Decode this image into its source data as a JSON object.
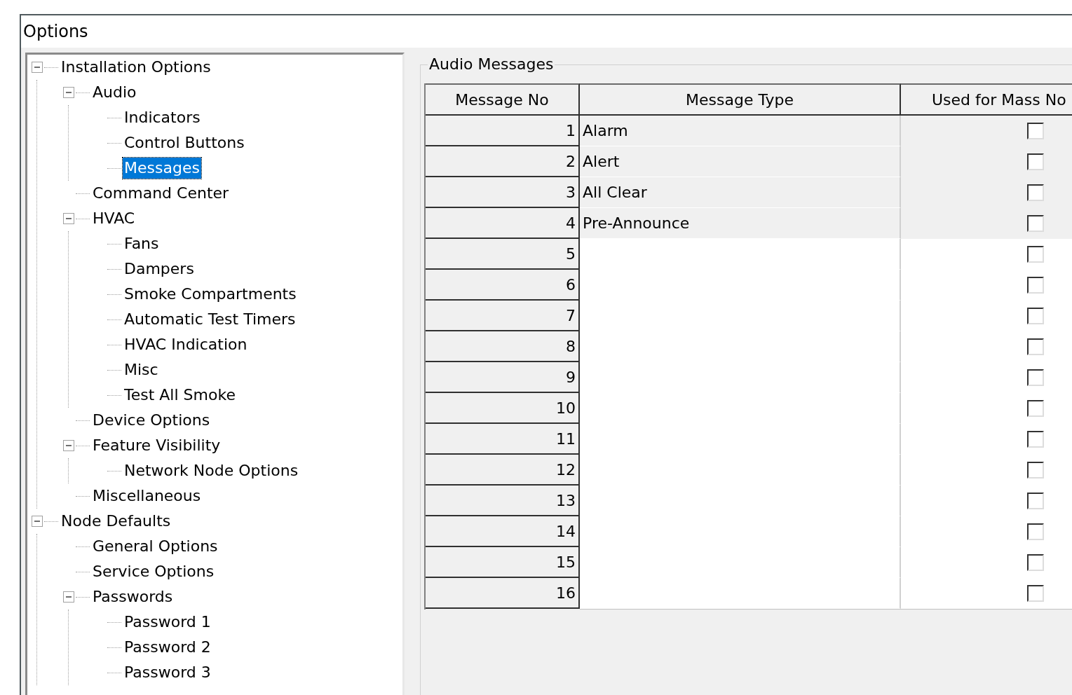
{
  "window": {
    "title": "Options"
  },
  "tree": [
    {
      "label": "Installation Options",
      "expanded": true,
      "selected": false,
      "children": [
        {
          "label": "Audio",
          "expanded": true,
          "selected": false,
          "children": [
            {
              "label": "Indicators",
              "selected": false
            },
            {
              "label": "Control Buttons",
              "selected": false
            },
            {
              "label": "Messages",
              "selected": true
            }
          ]
        },
        {
          "label": "Command Center",
          "selected": false
        },
        {
          "label": "HVAC",
          "expanded": true,
          "selected": false,
          "children": [
            {
              "label": "Fans",
              "selected": false
            },
            {
              "label": "Dampers",
              "selected": false
            },
            {
              "label": "Smoke Compartments",
              "selected": false
            },
            {
              "label": "Automatic Test Timers",
              "selected": false
            },
            {
              "label": "HVAC Indication",
              "selected": false
            },
            {
              "label": "Misc",
              "selected": false
            },
            {
              "label": "Test All Smoke",
              "selected": false
            }
          ]
        },
        {
          "label": "Device Options",
          "selected": false
        },
        {
          "label": "Feature Visibility",
          "expanded": true,
          "selected": false,
          "children": [
            {
              "label": "Network Node Options",
              "selected": false
            }
          ]
        },
        {
          "label": "Miscellaneous",
          "selected": false
        }
      ]
    },
    {
      "label": "Node Defaults",
      "expanded": true,
      "selected": false,
      "children": [
        {
          "label": "General Options",
          "selected": false
        },
        {
          "label": "Service Options",
          "selected": false
        },
        {
          "label": "Passwords",
          "expanded": true,
          "selected": false,
          "children": [
            {
              "label": "Password 1",
              "selected": false
            },
            {
              "label": "Password 2",
              "selected": false
            },
            {
              "label": "Password 3",
              "selected": false
            }
          ]
        }
      ]
    }
  ],
  "group": {
    "title": "Audio Messages",
    "table": {
      "columns": [
        "Message No",
        "Message Type",
        "Used for Mass No"
      ],
      "rows": [
        {
          "no": "1",
          "type": "Alarm",
          "checked": false
        },
        {
          "no": "2",
          "type": "Alert",
          "checked": false
        },
        {
          "no": "3",
          "type": "All Clear",
          "checked": false
        },
        {
          "no": "4",
          "type": "Pre-Announce",
          "checked": false
        },
        {
          "no": "5",
          "checked": false
        },
        {
          "no": "6",
          "checked": false
        },
        {
          "no": "7",
          "checked": false
        },
        {
          "no": "8",
          "checked": false
        },
        {
          "no": "9",
          "checked": false
        },
        {
          "no": "10",
          "checked": false
        },
        {
          "no": "11",
          "checked": false
        },
        {
          "no": "12",
          "checked": false
        },
        {
          "no": "13",
          "checked": false
        },
        {
          "no": "14",
          "checked": false
        },
        {
          "no": "15",
          "checked": false
        },
        {
          "no": "16",
          "checked": false
        }
      ]
    }
  }
}
